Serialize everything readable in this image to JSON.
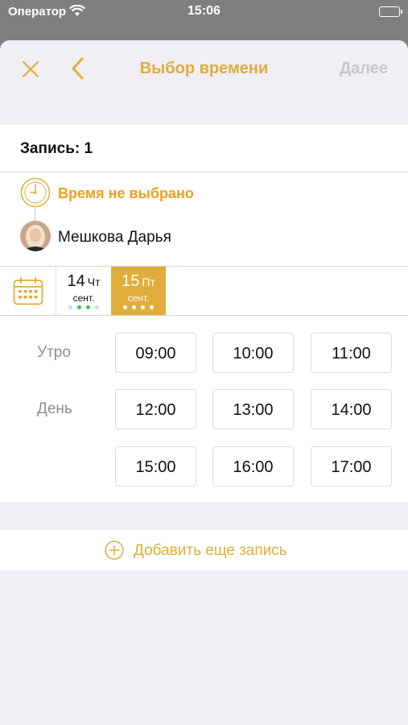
{
  "status_bar": {
    "carrier": "Оператор",
    "time": "15:06"
  },
  "nav": {
    "title": "Выбор времени",
    "next_label": "Далее"
  },
  "record": {
    "title": "Запись: 1",
    "time_status": "Время не выбрано",
    "specialist_name": "Мешкова Дарья"
  },
  "dates": [
    {
      "day": "14",
      "weekday": "Чт",
      "month": "сент."
    },
    {
      "day": "15",
      "weekday": "Пт",
      "month": "сент."
    }
  ],
  "periods": {
    "morning": "Утро",
    "day": "День"
  },
  "slots": [
    "09:00",
    "10:00",
    "11:00",
    "12:00",
    "13:00",
    "14:00",
    "15:00",
    "16:00",
    "17:00"
  ],
  "add_record_label": "Добавить еще запись",
  "colors": {
    "accent": "#e0ad3a",
    "warning": "#f0a020",
    "available": "#34c759",
    "muted": "#c7c7cc"
  }
}
